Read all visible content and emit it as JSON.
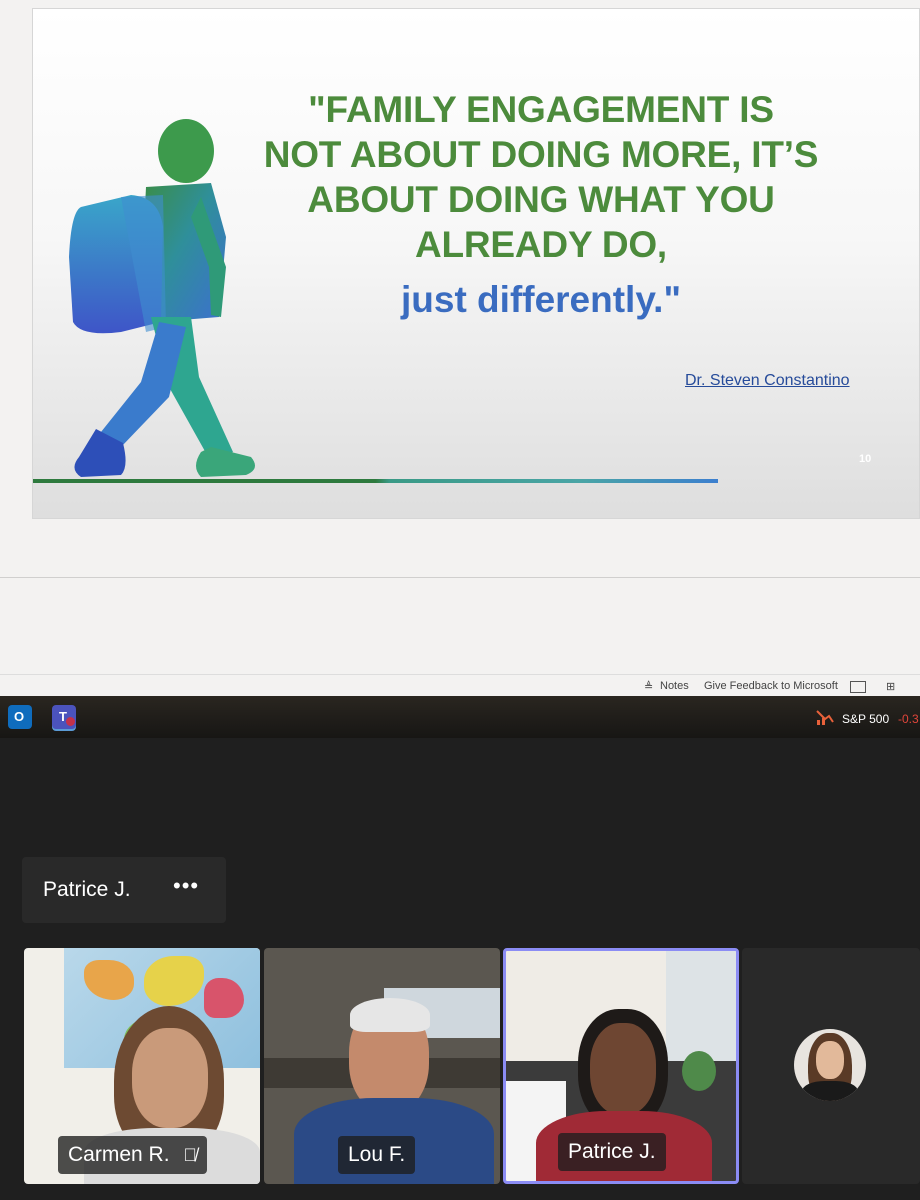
{
  "slide": {
    "quote_lines": [
      "\"FAMILY ENGAGEMENT IS",
      "NOT ABOUT DOING MORE, IT’S",
      "ABOUT DOING WHAT YOU",
      "ALREADY DO,"
    ],
    "quote_emphasis": "just differently.\"",
    "author": "Dr. Steven Constantino",
    "number": "10"
  },
  "statusbar": {
    "notes_label": "Notes",
    "feedback_label": "Give Feedback to Microsoft"
  },
  "taskbar": {
    "ticker_name": "S&P 500",
    "ticker_change": "-0.3"
  },
  "meeting": {
    "presenter_name": "Patrice J.",
    "more_label": "•••",
    "participants": [
      {
        "name": "Carmen R.",
        "muted": true
      },
      {
        "name": "Lou F."
      },
      {
        "name": "Patrice J.",
        "active": true
      },
      {
        "name": ""
      }
    ]
  },
  "colors": {
    "quote_green": "#4c8b3c",
    "quote_blue": "#3a6cc0",
    "active_border": "#8b8cf4",
    "teams_bg": "#1f1f1f"
  }
}
